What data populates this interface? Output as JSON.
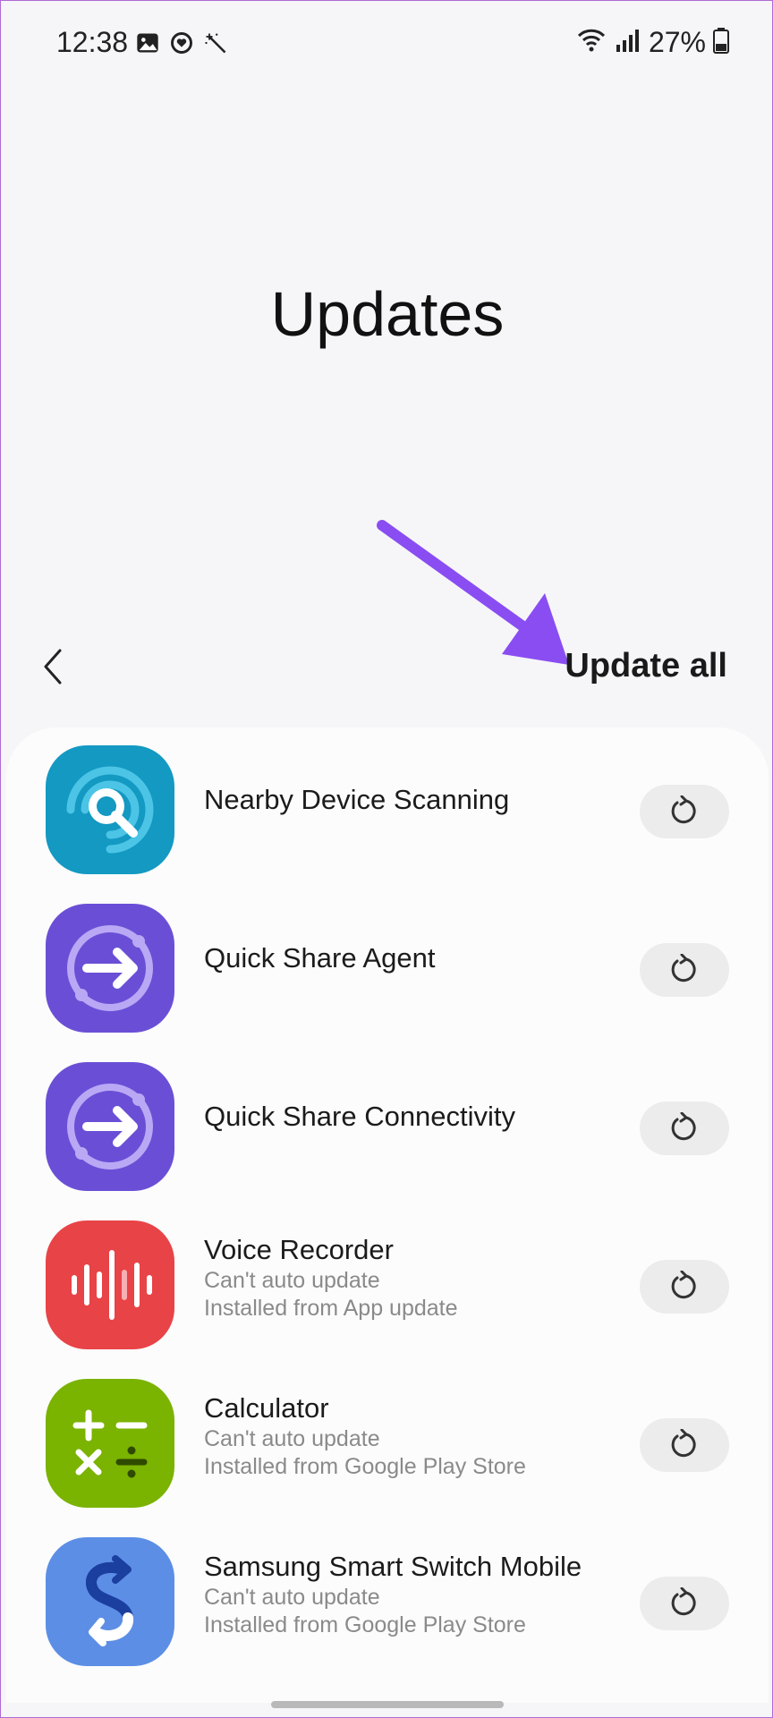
{
  "status_bar": {
    "time": "12:38",
    "battery": "27%",
    "left_icons": [
      "gallery-icon",
      "heart-sync-icon",
      "magic-wand-icon"
    ],
    "right_icons": [
      "wifi-icon",
      "signal-icon",
      "battery-icon"
    ]
  },
  "header": {
    "title": "Updates",
    "update_all_label": "Update all"
  },
  "apps": [
    {
      "name": "Nearby Device Scanning",
      "status": "",
      "source": "",
      "icon": "nearby-scan-icon"
    },
    {
      "name": "Quick Share Agent",
      "status": "",
      "source": "",
      "icon": "quick-share-icon"
    },
    {
      "name": "Quick Share Connectivity",
      "status": "",
      "source": "",
      "icon": "quick-share-icon"
    },
    {
      "name": "Voice Recorder",
      "status": "Can't auto update",
      "source": "Installed from App update",
      "icon": "voice-recorder-icon"
    },
    {
      "name": "Calculator",
      "status": "Can't auto update",
      "source": "Installed from Google Play Store",
      "icon": "calculator-icon"
    },
    {
      "name": "Samsung Smart Switch Mobile",
      "status": "Can't auto update",
      "source": "Installed from Google Play Store",
      "icon": "smart-switch-icon"
    }
  ],
  "colors": {
    "annotation_arrow": "#8a4df2",
    "nearby_scan": "#1399c2",
    "quick_share": "#6a4fd6",
    "voice_recorder": "#e84347",
    "calculator": "#7ab300",
    "smart_switch": "#5c8ee6"
  }
}
